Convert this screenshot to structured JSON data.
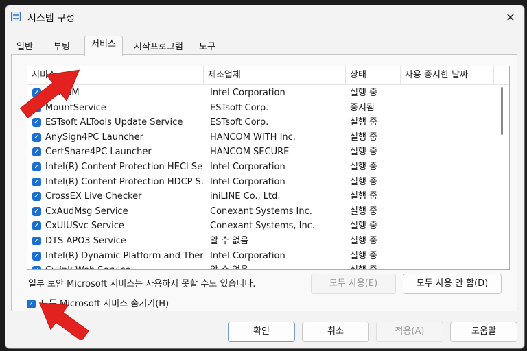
{
  "window": {
    "title": "시스템 구성"
  },
  "tabs": [
    "일반",
    "부팅",
    "서비스",
    "시작프로그램",
    "도구"
  ],
  "table": {
    "headers": [
      "서비스",
      "제조업체",
      "상태",
      "사용 중지한 날짜"
    ],
    "rows": [
      {
        "name": "X AESM",
        "maker": "Intel Corporation",
        "status": "실행 중"
      },
      {
        "name": "MountService",
        "maker": "ESTsoft Corp.",
        "status": "중지됨"
      },
      {
        "name": "ESTsoft ALTools Update Service",
        "maker": "ESTsoft Corp.",
        "status": "실행 중"
      },
      {
        "name": "AnySign4PC Launcher",
        "maker": "HANCOM WITH Inc.",
        "status": "실행 중"
      },
      {
        "name": "CertShare4PC Launcher",
        "maker": "HANCOM SECURE",
        "status": "실행 중"
      },
      {
        "name": "Intel(R) Content Protection HECI Se...",
        "maker": "Intel Corporation",
        "status": "실행 중"
      },
      {
        "name": "Intel(R) Content Protection HDCP S...",
        "maker": "Intel Corporation",
        "status": "실행 중"
      },
      {
        "name": "CrossEX Live Checker",
        "maker": "iniLINE Co., Ltd.",
        "status": "실행 중"
      },
      {
        "name": "CxAudMsg Service",
        "maker": "Conexant Systems Inc.",
        "status": "실행 중"
      },
      {
        "name": "CxUIUSvc Service",
        "maker": "Conexant Systems, Inc.",
        "status": "실행 중"
      },
      {
        "name": "DTS APO3 Service",
        "maker": "알 수 없음",
        "status": "실행 중"
      },
      {
        "name": "Intel(R) Dynamic Platform and Ther...",
        "maker": "Intel Corporation",
        "status": "실행 중"
      },
      {
        "name": "Cylink Web Service",
        "maker": "알 수 없음",
        "status": "실행 중"
      }
    ]
  },
  "note": "일부 보안 Microsoft 서비스는 사용하지 못할 수도 있습니다.",
  "buttons": {
    "enable_all": "모두 사용(E)",
    "disable_all": "모두 사용 안 함(D)",
    "ok": "확인",
    "cancel": "취소",
    "apply": "적용(A)",
    "help": "도움말"
  },
  "hide_ms": {
    "label": "모든 Microsoft 서비스 숨기기(H)",
    "checked": true
  },
  "colors": {
    "accent": "#1b6fd1",
    "arrow": "#e3221f"
  },
  "icons": {
    "check": "✓",
    "close": "✕"
  }
}
